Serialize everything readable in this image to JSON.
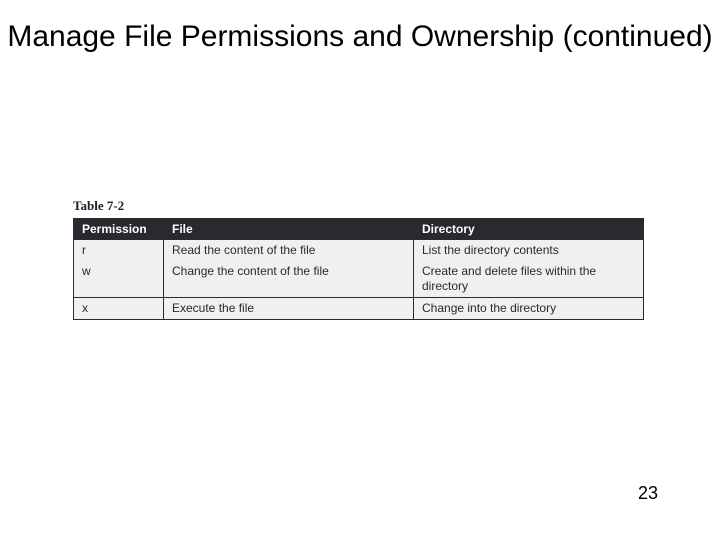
{
  "title": "Manage File Permissions and Ownership (continued)",
  "table": {
    "label": "Table 7-2",
    "headers": {
      "permission": "Permission",
      "file": "File",
      "directory": "Directory"
    },
    "rows": [
      {
        "permission": "r",
        "file": "Read the content of the file",
        "directory": "List the directory contents"
      },
      {
        "permission": "w",
        "file": "Change the content of the file",
        "directory": "Create and delete files within the directory"
      },
      {
        "permission": "x",
        "file": "Execute the file",
        "directory": "Change into the directory"
      }
    ]
  },
  "page_number": "23"
}
